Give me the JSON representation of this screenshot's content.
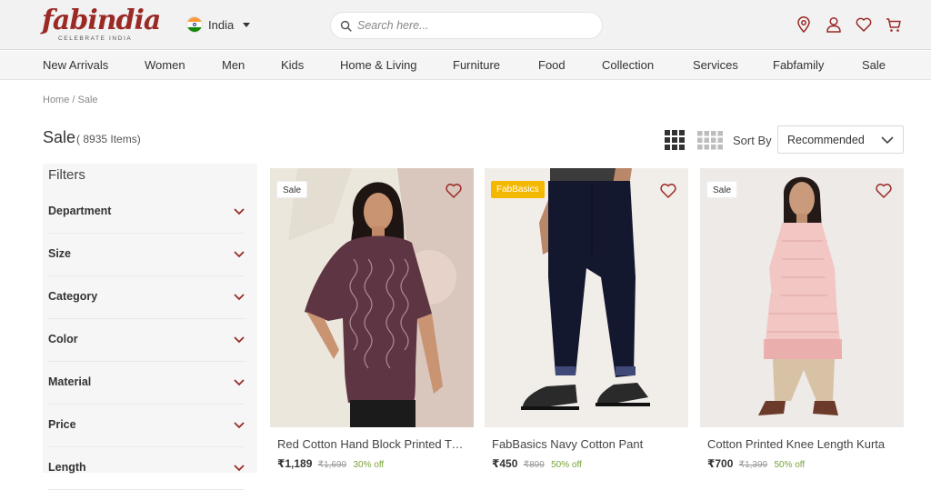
{
  "brand": {
    "name": "fabindia",
    "tagline": "CELEBRATE INDIA",
    "color": "#9a2a26"
  },
  "country": {
    "label": "India",
    "icon": "india-flag-icon"
  },
  "search": {
    "placeholder": "Search here..."
  },
  "header_icons": [
    "location-pin-icon",
    "user-icon",
    "heart-icon",
    "cart-icon"
  ],
  "nav": {
    "items": [
      "New Arrivals",
      "Women",
      "Men",
      "Kids",
      "Home & Living",
      "Furniture",
      "Food",
      "Collection",
      "Services",
      "Fabfamily",
      "Sale"
    ]
  },
  "breadcrumb": "Home / Sale",
  "page": {
    "title": "Sale",
    "count": "( 8935 Items)"
  },
  "sort": {
    "label": "Sort By",
    "selected": "Recommended"
  },
  "filters": {
    "title": "Filters",
    "items": [
      "Department",
      "Size",
      "Category",
      "Color",
      "Material",
      "Price",
      "Length"
    ]
  },
  "products": [
    {
      "badge": "Sale",
      "name": "Red Cotton Hand Block Printed Tunic",
      "price": "₹1,189",
      "original": "₹1,699",
      "discount": "30% off"
    },
    {
      "badge": "FabBasics",
      "name": "FabBasics Navy Cotton Pant",
      "price": "₹450",
      "original": "₹899",
      "discount": "50% off"
    },
    {
      "badge": "Sale",
      "name": "Cotton Printed Knee Length Kurta",
      "price": "₹700",
      "original": "₹1,399",
      "discount": "50% off"
    }
  ],
  "colors": {
    "badge_fabbasics": "#f5b800",
    "discount": "#7aa23a"
  }
}
